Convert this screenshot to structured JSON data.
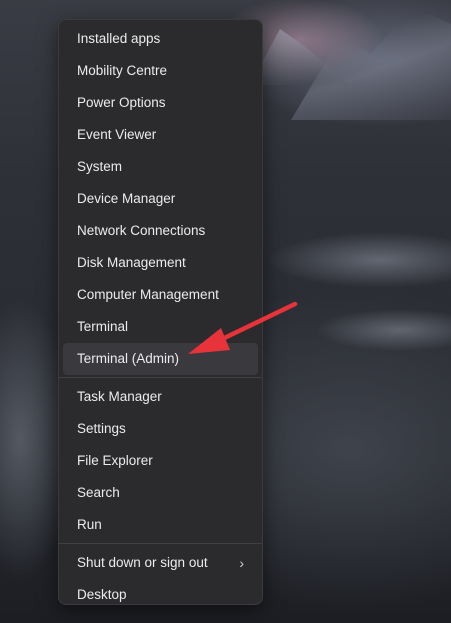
{
  "menu": {
    "group1": [
      "Installed apps",
      "Mobility Centre",
      "Power Options",
      "Event Viewer",
      "System",
      "Device Manager",
      "Network Connections",
      "Disk Management",
      "Computer Management",
      "Terminal",
      "Terminal (Admin)"
    ],
    "group2": [
      "Task Manager",
      "Settings",
      "File Explorer",
      "Search",
      "Run"
    ],
    "group3": [
      "Shut down or sign out",
      "Desktop"
    ],
    "highlighted_item": "Terminal (Admin)",
    "submenu_icon": "chevron-right-icon"
  },
  "annotation": {
    "type": "arrow",
    "color": "#e8333a",
    "points_to": "Terminal (Admin)"
  }
}
